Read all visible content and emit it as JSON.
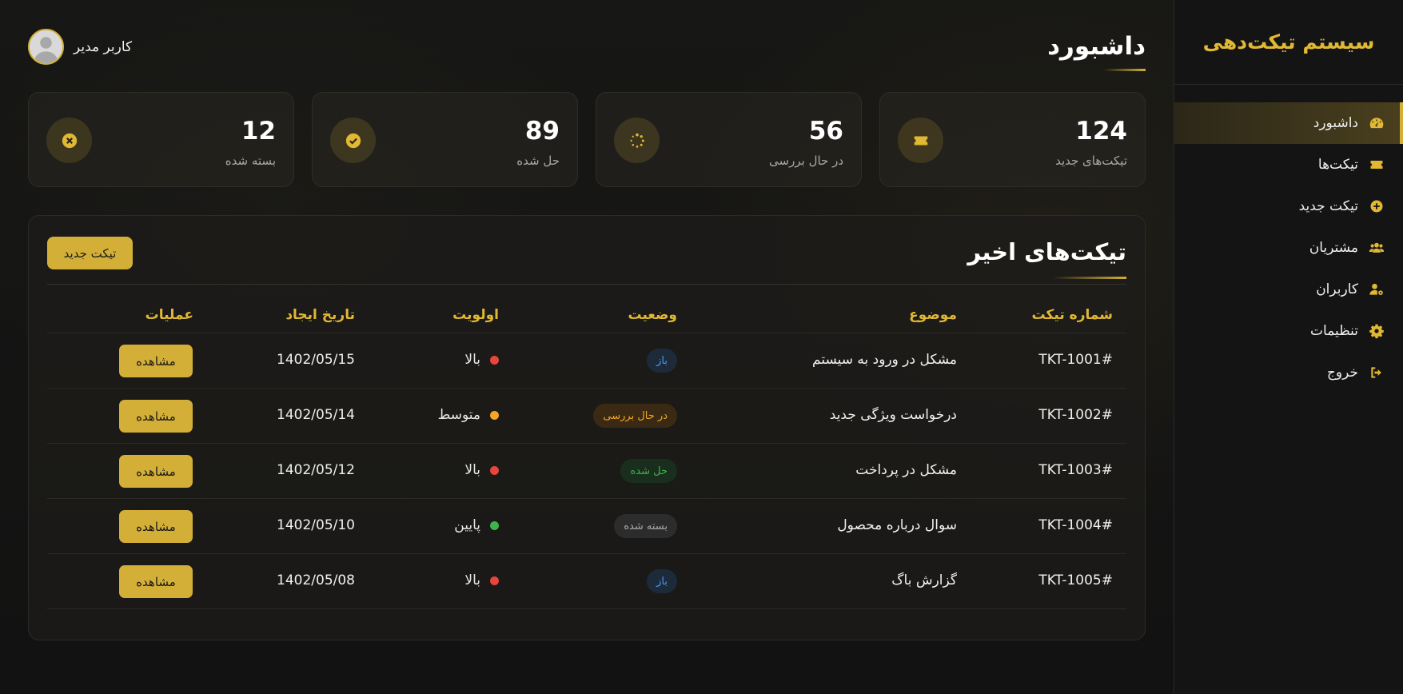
{
  "sidebar": {
    "brand": "سیستم تیکت‌دهی",
    "items": [
      {
        "label": "داشبورد",
        "icon": "dashboard-gauge-icon",
        "active": true
      },
      {
        "label": "تیکت‌ها",
        "icon": "ticket-icon",
        "active": false
      },
      {
        "label": "تیکت جدید",
        "icon": "plus-circle-icon",
        "active": false
      },
      {
        "label": "مشتریان",
        "icon": "users-icon",
        "active": false
      },
      {
        "label": "کاربران",
        "icon": "user-gear-icon",
        "active": false
      },
      {
        "label": "تنظیمات",
        "icon": "gear-icon",
        "active": false
      },
      {
        "label": "خروج",
        "icon": "logout-icon",
        "active": false
      }
    ]
  },
  "header": {
    "title": "داشبورد",
    "user_name": "کاربر مدیر"
  },
  "stats": [
    {
      "value": "124",
      "label": "تیکت‌های جدید",
      "icon": "ticket-icon"
    },
    {
      "value": "56",
      "label": "در حال بررسی",
      "icon": "spinner-icon"
    },
    {
      "value": "89",
      "label": "حل شده",
      "icon": "check-circle-icon"
    },
    {
      "value": "12",
      "label": "بسته شده",
      "icon": "x-circle-icon"
    }
  ],
  "recent": {
    "title": "تیکت‌های اخیر",
    "new_button": "تیکت جدید",
    "columns": {
      "id": "شماره تیکت",
      "subject": "موضوع",
      "status": "وضعیت",
      "priority": "اولویت",
      "date": "تاریخ ایجاد",
      "actions": "عملیات"
    },
    "rows": [
      {
        "id": "TKT-1001#",
        "subject": "مشکل در ورود به سیستم",
        "status": "باز",
        "status_kind": "open",
        "priority": "بالا",
        "priority_color": "#e8453c",
        "date": "1402/05/15",
        "action": "مشاهده"
      },
      {
        "id": "TKT-1002#",
        "subject": "درخواست ویژگی جدید",
        "status": "در حال بررسی",
        "status_kind": "review",
        "priority": "متوسط",
        "priority_color": "#f5a623",
        "date": "1402/05/14",
        "action": "مشاهده"
      },
      {
        "id": "TKT-1003#",
        "subject": "مشکل در پرداخت",
        "status": "حل شده",
        "status_kind": "solved",
        "priority": "بالا",
        "priority_color": "#e8453c",
        "date": "1402/05/12",
        "action": "مشاهده"
      },
      {
        "id": "TKT-1004#",
        "subject": "سوال درباره محصول",
        "status": "بسته شده",
        "status_kind": "closed",
        "priority": "پایین",
        "priority_color": "#3cb44b",
        "date": "1402/05/10",
        "action": "مشاهده"
      },
      {
        "id": "TKT-1005#",
        "subject": "گزارش باگ",
        "status": "باز",
        "status_kind": "open",
        "priority": "بالا",
        "priority_color": "#e8453c",
        "date": "1402/05/08",
        "action": "مشاهده"
      }
    ]
  },
  "colors": {
    "accent": "#d4af37",
    "background": "#121212"
  }
}
